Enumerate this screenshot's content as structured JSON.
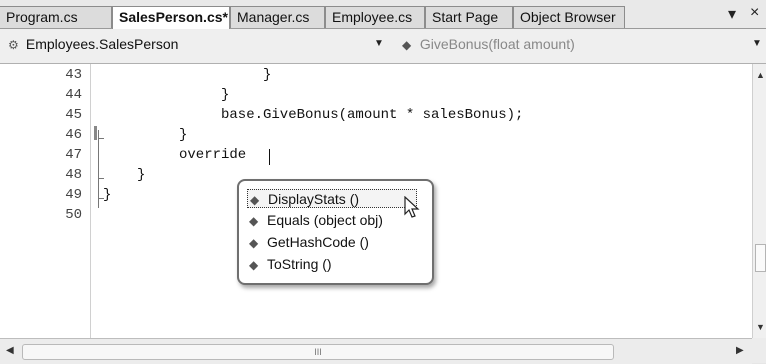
{
  "tabs": [
    {
      "label": "Program.cs",
      "active": false
    },
    {
      "label": "SalesPerson.cs*",
      "active": true
    },
    {
      "label": "Manager.cs",
      "active": false
    },
    {
      "label": "Employee.cs",
      "active": false
    },
    {
      "label": "Start Page",
      "active": false
    },
    {
      "label": "Object Browser",
      "active": false
    }
  ],
  "tab_controls": {
    "dropdown_glyph": "▾",
    "close_glyph": "×"
  },
  "navigation": {
    "type_combo": {
      "value": "Employees.SalesPerson",
      "icon": "class-icon"
    },
    "member_combo": {
      "value": "GiveBonus(float amount)",
      "icon": "method-icon"
    }
  },
  "editor": {
    "lines": [
      {
        "number": "43",
        "text": "}"
      },
      {
        "number": "44",
        "text": "}"
      },
      {
        "number": "45",
        "text": "base.GiveBonus(amount * salesBonus);"
      },
      {
        "number": "46",
        "text": "}"
      },
      {
        "number": "47",
        "text": "override "
      },
      {
        "number": "48",
        "text": "}"
      },
      {
        "number": "49",
        "text": "}"
      },
      {
        "number": "50",
        "text": ""
      }
    ]
  },
  "intellisense": {
    "items": [
      {
        "label": "DisplayStats ()",
        "icon": "method-icon",
        "selected": true
      },
      {
        "label": "Equals (object obj)",
        "icon": "method-icon",
        "selected": false
      },
      {
        "label": "GetHashCode ()",
        "icon": "method-icon",
        "selected": false
      },
      {
        "label": "ToString ()",
        "icon": "method-icon",
        "selected": false
      }
    ]
  },
  "scrollbar": {
    "thumb_grip": "III"
  }
}
